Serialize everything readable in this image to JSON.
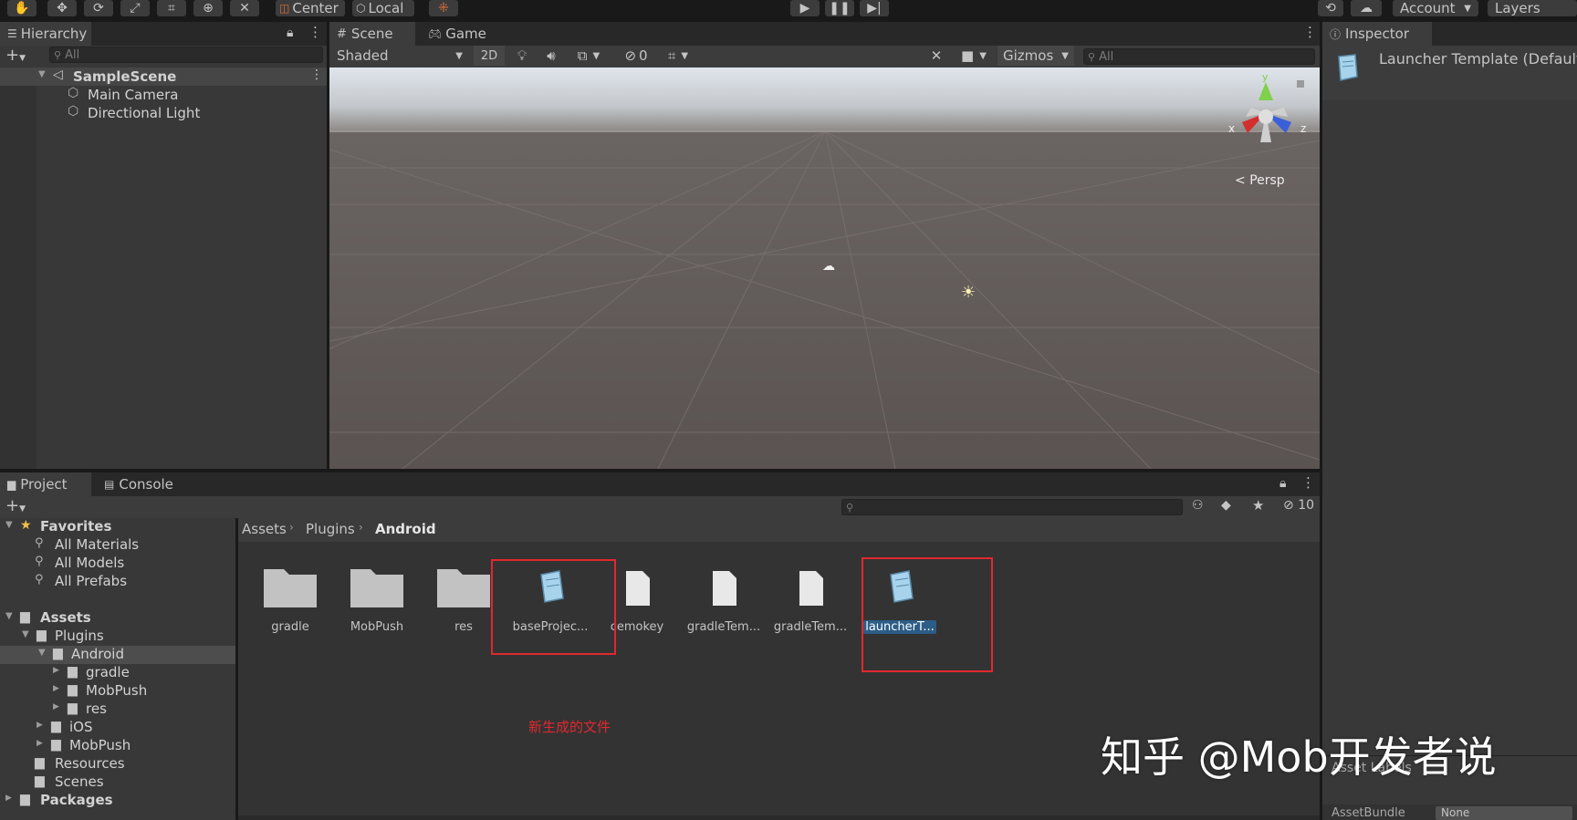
{
  "toolbar": {
    "pivot_label": "Center",
    "space_label": "Local",
    "account_label": "Account",
    "layers_label": "Layers"
  },
  "hierarchy": {
    "tab_label": "Hierarchy",
    "search_placeholder": "All",
    "scene_name": "SampleScene",
    "items": [
      {
        "label": "Main Camera"
      },
      {
        "label": "Directional Light"
      }
    ]
  },
  "scene_view": {
    "tabs": [
      {
        "label": "Scene"
      },
      {
        "label": "Game"
      }
    ],
    "shading_mode": "Shaded",
    "mode_2d": "2D",
    "hidden_count": "0",
    "gizmos_label": "Gizmos",
    "search_placeholder": "All",
    "persp_label": "Persp",
    "axis_x": "x",
    "axis_y": "y",
    "axis_z": "z",
    "sky_color": "#c9d0d8",
    "ground_color": "#5c5553"
  },
  "inspector": {
    "tab_label": "Inspector",
    "title": "Launcher Template (Default",
    "asset_labels": "Asset Labels",
    "asset_bundle_label": "AssetBundle",
    "asset_bundle_value": "None"
  },
  "project": {
    "tabs": [
      {
        "label": "Project"
      },
      {
        "label": "Console"
      }
    ],
    "hidden_count": "10",
    "breadcrumb": [
      "Assets",
      "Plugins",
      "Android"
    ],
    "favorites": {
      "label": "Favorites",
      "items": [
        {
          "label": "All Materials"
        },
        {
          "label": "All Models"
        },
        {
          "label": "All Prefabs"
        }
      ]
    },
    "tree": {
      "assets_label": "Assets",
      "plugins_label": "Plugins",
      "android_label": "Android",
      "android_children": [
        {
          "label": "gradle"
        },
        {
          "label": "MobPush"
        },
        {
          "label": "res"
        }
      ],
      "ios_label": "iOS",
      "mobpush_label": "MobPush",
      "resources_label": "Resources",
      "scenes_label": "Scenes",
      "packages_label": "Packages"
    },
    "grid_items": [
      {
        "label": "gradle",
        "kind": "folder"
      },
      {
        "label": "MobPush",
        "kind": "folder"
      },
      {
        "label": "res",
        "kind": "folder"
      },
      {
        "label": "baseProjec...",
        "kind": "template"
      },
      {
        "label": "cemokey",
        "kind": "file"
      },
      {
        "label": "gradleTem...",
        "kind": "file"
      },
      {
        "label": "gradleTem...",
        "kind": "file"
      },
      {
        "label": "launcherT...",
        "kind": "template",
        "selected": true
      }
    ],
    "annotation_note": "新生成的文件",
    "highlight_color": "#e0282e"
  },
  "watermark": "知乎 @Mob开发者说"
}
